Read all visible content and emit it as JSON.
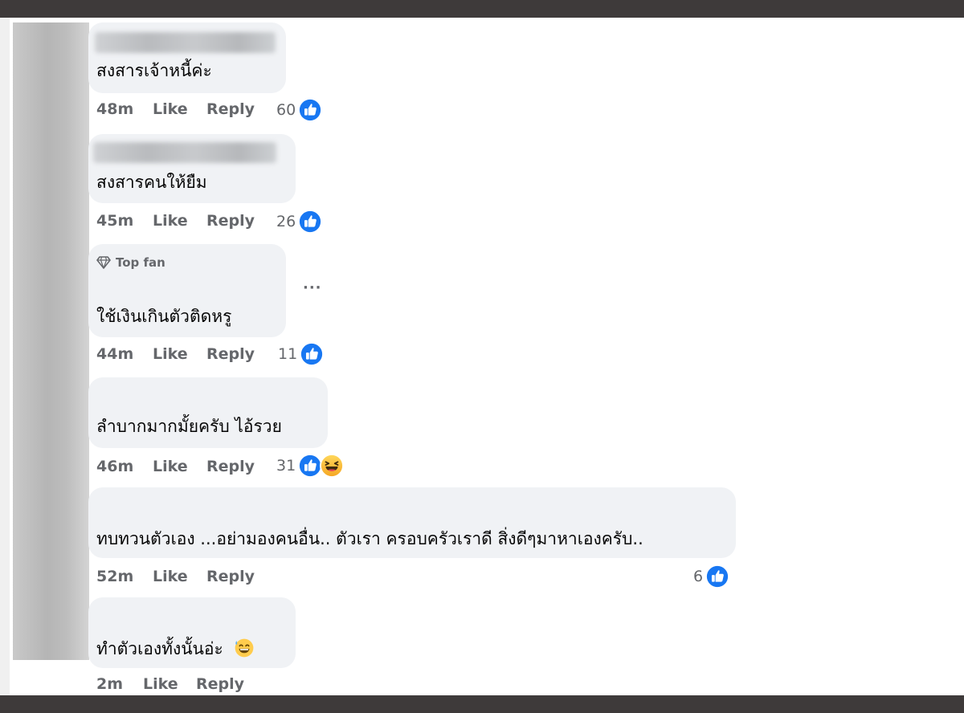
{
  "comments": [
    {
      "text": "สงสารเจ้าหนี้ค่ะ",
      "time": "48m",
      "like_label": "Like",
      "reply_label": "Reply",
      "reaction_count": "60",
      "reactions": [
        "like-icon"
      ]
    },
    {
      "text": "สงสารคนให้ยืม",
      "time": "45m",
      "like_label": "Like",
      "reply_label": "Reply",
      "reaction_count": "26",
      "reactions": [
        "like-icon"
      ]
    },
    {
      "badge": "Top fan",
      "text": "ใช้เงินเกินตัวติดหรู",
      "time": "44m",
      "like_label": "Like",
      "reply_label": "Reply",
      "reaction_count": "11",
      "more_label": "···",
      "reactions": [
        "like-icon"
      ]
    },
    {
      "text": "ลำบากมากมั้ยครับ ไอ้รวย",
      "time": "46m",
      "like_label": "Like",
      "reply_label": "Reply",
      "reaction_count": "31",
      "reactions": [
        "like-icon",
        "haha-icon"
      ]
    },
    {
      "text": "ทบทวนตัวเอง ...อย่ามองคนอื่น.. ตัวเรา ครอบครัวเราดี สิ่งดีๆมาหาเองครับ..",
      "time": "52m",
      "like_label": "Like",
      "reply_label": "Reply",
      "reaction_count": "6",
      "reactions": [
        "like-icon"
      ]
    },
    {
      "text": "ทำตัวเองทั้งนั้นอ่ะ",
      "time": "2m",
      "like_label": "Like",
      "reply_label": "Reply",
      "reactions": [
        "grinning-sweat-emoji"
      ]
    }
  ],
  "colors": {
    "bubble": "#f0f2f5",
    "meta_text": "#65676b",
    "like_blue": "#1877f2",
    "frame": "#3e3a3a"
  }
}
